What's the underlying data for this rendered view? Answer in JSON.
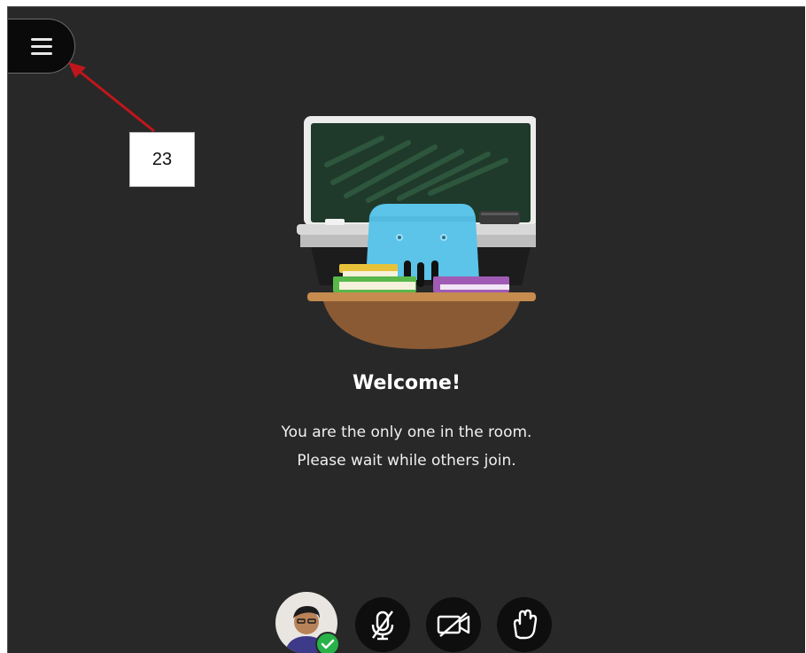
{
  "menu": {
    "icon": "hamburger-icon"
  },
  "annotation": {
    "callout_number": "23",
    "arrow_color": "#c0161b"
  },
  "illustration": {
    "icon": "classroom-illustration",
    "colors": {
      "chalkboard": "#1f3a2a",
      "board_frame": "#ececec",
      "desk_top": "#c58b4f",
      "desk_bowl": "#8a5a34",
      "chair": "#5bc4e8"
    }
  },
  "welcome": {
    "title": "Welcome!",
    "line1": "You are the only one in the room.",
    "line2": "Please wait while others join."
  },
  "controls": {
    "avatar_icon": "user-avatar",
    "status_icon": "check-icon",
    "status_color": "#27b24a",
    "microphone_icon": "microphone-muted-icon",
    "camera_icon": "camera-off-icon",
    "hand_icon": "raise-hand-icon"
  }
}
